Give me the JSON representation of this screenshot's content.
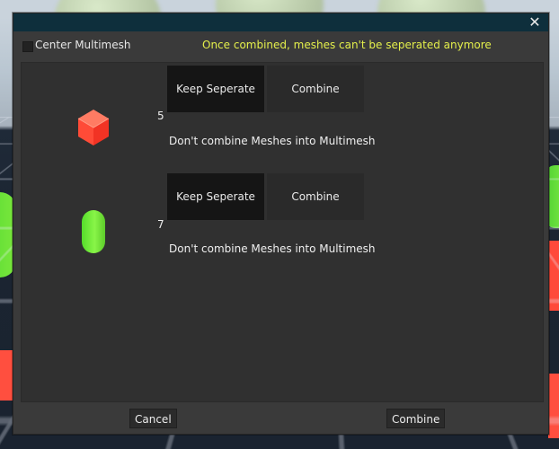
{
  "dialog": {
    "close_icon": "close-icon",
    "center_multimesh_label": "Center Multimesh",
    "center_multimesh_checked": false,
    "warning": "Once combined, meshes can't be seperated anymore"
  },
  "items": [
    {
      "icon": "red-cube-icon",
      "count": "5",
      "keep_label": "Keep Seperate",
      "combine_label": "Combine",
      "description": "Don't combine Meshes into Multimesh"
    },
    {
      "icon": "green-capsule-icon",
      "count": "7",
      "keep_label": "Keep Seperate",
      "combine_label": "Combine",
      "description": "Don't combine Meshes into Multimesh"
    }
  ],
  "footer": {
    "cancel_label": "Cancel",
    "combine_label": "Combine"
  },
  "colors": {
    "warning": "#e4ef4b",
    "titlebar": "#0e2f3c",
    "dialog_bg": "#3a3a3a",
    "content_bg": "#303030"
  }
}
